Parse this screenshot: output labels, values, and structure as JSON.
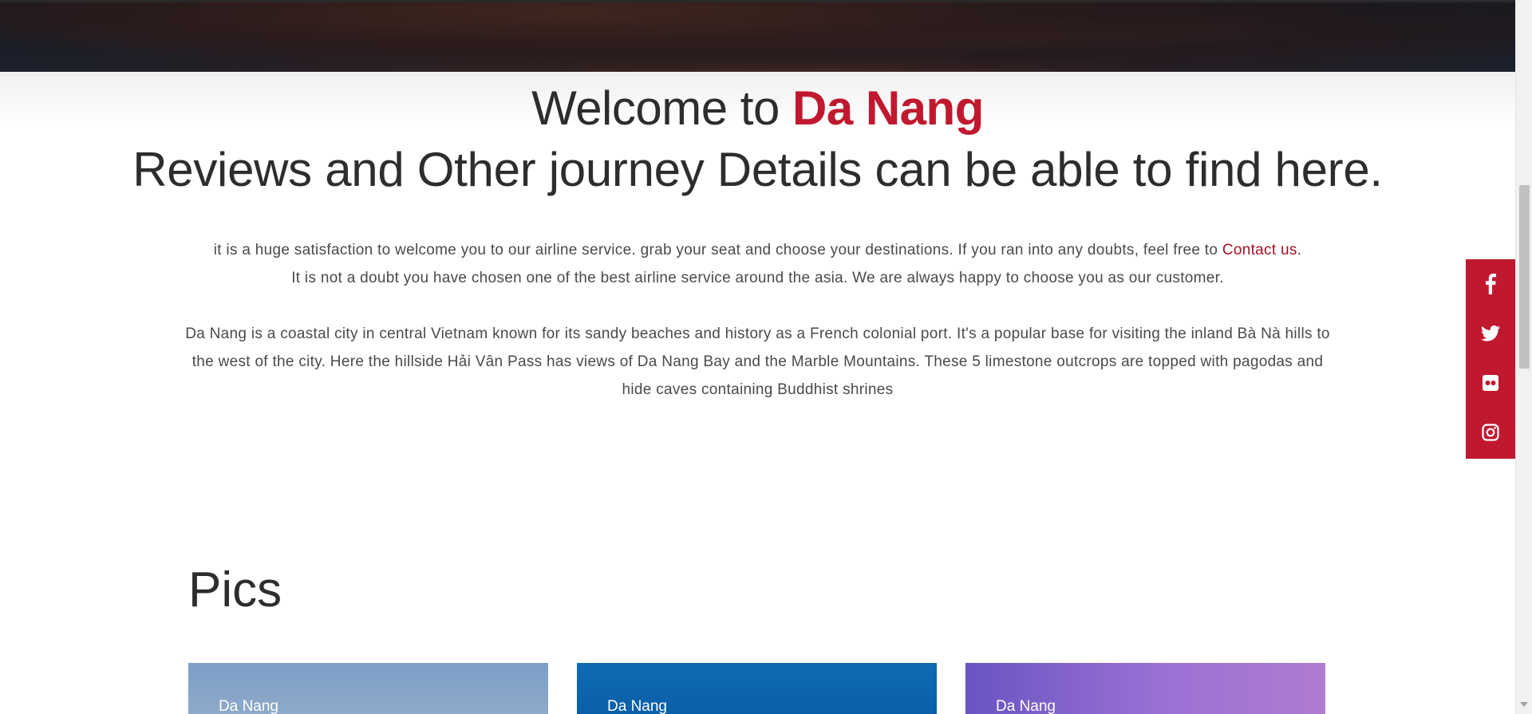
{
  "welcome": {
    "prefix": "Welcome to ",
    "city": "Da Nang"
  },
  "subtitle": "Reviews and Other journey Details can be able to find here.",
  "intro": {
    "line1_before": "it is a huge satisfaction to welcome you to our airline service. grab your seat and choose your destinations. If you ran into any doubts, feel free to ",
    "contact_link": "Contact us",
    "line1_after": ".",
    "line2": "It is not a doubt you have chosen one of the best airline service around the asia. We are always happy to choose you as our customer."
  },
  "description": "Da Nang is a coastal city in central Vietnam known for its sandy beaches and history as a French colonial port. It's a popular base for visiting the inland Bà Nà hills to the west of the city. Here the hillside Hải Vân Pass has views of Da Nang Bay and the Marble Mountains. These 5 limestone outcrops are topped with pagodas and hide caves containing Buddhist shrines",
  "pics": {
    "heading": "Pics",
    "cards": [
      {
        "label": "Da Nang"
      },
      {
        "label": "Da Nang"
      },
      {
        "label": "Da Nang"
      }
    ]
  },
  "social": {
    "items": [
      {
        "icon": "facebook-icon"
      },
      {
        "icon": "twitter-icon"
      },
      {
        "icon": "flickr-icon"
      },
      {
        "icon": "instagram-icon"
      }
    ]
  },
  "colors": {
    "accent": "#c0192f",
    "link": "#a01226",
    "text": "#2d2d2d",
    "body_text": "#4a4a4a"
  }
}
